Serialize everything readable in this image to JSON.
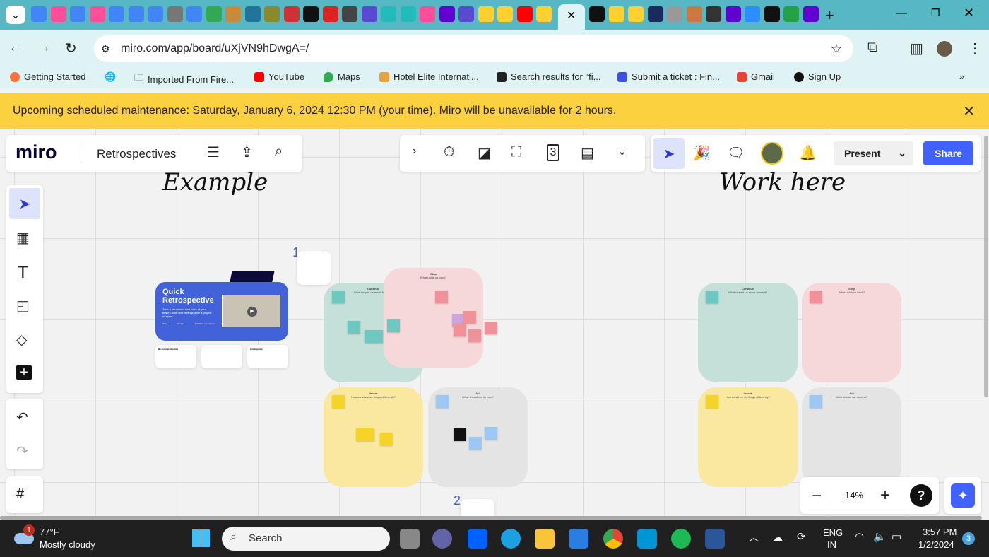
{
  "browser": {
    "tabs": [
      {
        "icon": "docs-icon",
        "color": "#4285f4"
      },
      {
        "icon": "clickup-icon",
        "color": "#ff4f9a"
      },
      {
        "icon": "docs-icon",
        "color": "#4285f4"
      },
      {
        "icon": "clickup-icon",
        "color": "#ff4f9a"
      },
      {
        "icon": "docs-icon",
        "color": "#4285f4"
      },
      {
        "icon": "docs-icon",
        "color": "#4285f4"
      },
      {
        "icon": "docs-icon",
        "color": "#4285f4"
      },
      {
        "icon": "cc-icon",
        "color": "#777"
      },
      {
        "icon": "docs-icon",
        "color": "#4285f4"
      },
      {
        "icon": "drive-icon",
        "color": "#34a853"
      },
      {
        "icon": "site-icon",
        "color": "#c98a3a"
      },
      {
        "icon": "wordpress-icon",
        "color": "#21759b"
      },
      {
        "icon": "site-icon",
        "color": "#8a8a2a"
      },
      {
        "icon": "site-icon",
        "color": "#c33"
      },
      {
        "icon": "c-icon",
        "color": "#111"
      },
      {
        "icon": "pc-icon",
        "color": "#d22"
      },
      {
        "icon": "site-icon",
        "color": "#444"
      },
      {
        "icon": "site-icon",
        "color": "#5a4ad1"
      },
      {
        "icon": "site-icon",
        "color": "#2bb"
      },
      {
        "icon": "site-icon",
        "color": "#2bb"
      },
      {
        "icon": "clickup-icon",
        "color": "#ff4f9a"
      },
      {
        "icon": "yahoo-icon",
        "color": "#6001d2"
      },
      {
        "icon": "site-icon",
        "color": "#5a4ad1"
      },
      {
        "icon": "miro-icon",
        "color": "#ffd02f"
      },
      {
        "icon": "miro-icon",
        "color": "#ffd02f"
      },
      {
        "icon": "youtube-icon",
        "color": "#f00"
      },
      {
        "icon": "miro-icon",
        "color": "#ffd02f"
      }
    ],
    "tabs_after": [
      {
        "icon": "c-icon",
        "color": "#111"
      },
      {
        "icon": "miro-icon",
        "color": "#ffd02f"
      },
      {
        "icon": "miro-icon",
        "color": "#ffd02f"
      },
      {
        "icon": "d-icon",
        "color": "#1a2a5a"
      },
      {
        "icon": "site-icon",
        "color": "#999"
      },
      {
        "icon": "site-icon",
        "color": "#c74"
      },
      {
        "icon": "site-icon",
        "color": "#333"
      },
      {
        "icon": "yahoo-icon",
        "color": "#6001d2"
      },
      {
        "icon": "share-icon",
        "color": "#2d8cff"
      },
      {
        "icon": "site-icon",
        "color": "#111"
      },
      {
        "icon": "site-icon",
        "color": "#25a244"
      },
      {
        "icon": "yahoo-icon",
        "color": "#6001d2"
      }
    ],
    "url": "miro.com/app/board/uXjVN9hDwgA=/",
    "bookmarks": [
      "Getting Started",
      "",
      "Imported From Fire...",
      "YouTube",
      "Maps",
      "Hotel Elite Internati...",
      "Search results for \"fi...",
      "Submit a ticket : Fin...",
      "Gmail",
      "Sign Up"
    ]
  },
  "banner": {
    "text": "Upcoming scheduled maintenance: Saturday, January 6, 2024 12:30 PM (your time). Miro will be unavailable for 2 hours."
  },
  "miro": {
    "logo": "miro",
    "board_name": "Retrospectives",
    "present": "Present",
    "share": "Share",
    "zoom": "14%",
    "help": "?",
    "example_heading": "Example",
    "work_heading": "Work here",
    "step1": "1",
    "step2": "2",
    "card": {
      "title": "Quick Retrospective",
      "subtitle": "Take a structured look back at your team's work and feelings after a project or sprint.",
      "stats": [
        "Time",
        "People",
        "Facilitation experience"
      ]
    },
    "info_cards": [
      "Be more productive",
      "",
      "Get inspired"
    ],
    "quadrants": [
      {
        "title": "Continue",
        "question": "What helped us move forward?",
        "color": "#c5e0d8"
      },
      {
        "title": "Stop",
        "question": "What holds us back?",
        "color": "#f7d8da"
      },
      {
        "title": "Invent",
        "question": "How could we do things differently?",
        "color": "#fbe8a0"
      },
      {
        "title": "Act",
        "question": "What should we do next?",
        "color": "#e4e4e4"
      }
    ]
  },
  "taskbar": {
    "temp": "77°F",
    "weather": "Mostly cloudy",
    "weather_badge": "1",
    "search": "Search",
    "lang1": "ENG",
    "lang2": "IN",
    "time": "3:57 PM",
    "date": "1/2/2024",
    "notifications": "3"
  }
}
